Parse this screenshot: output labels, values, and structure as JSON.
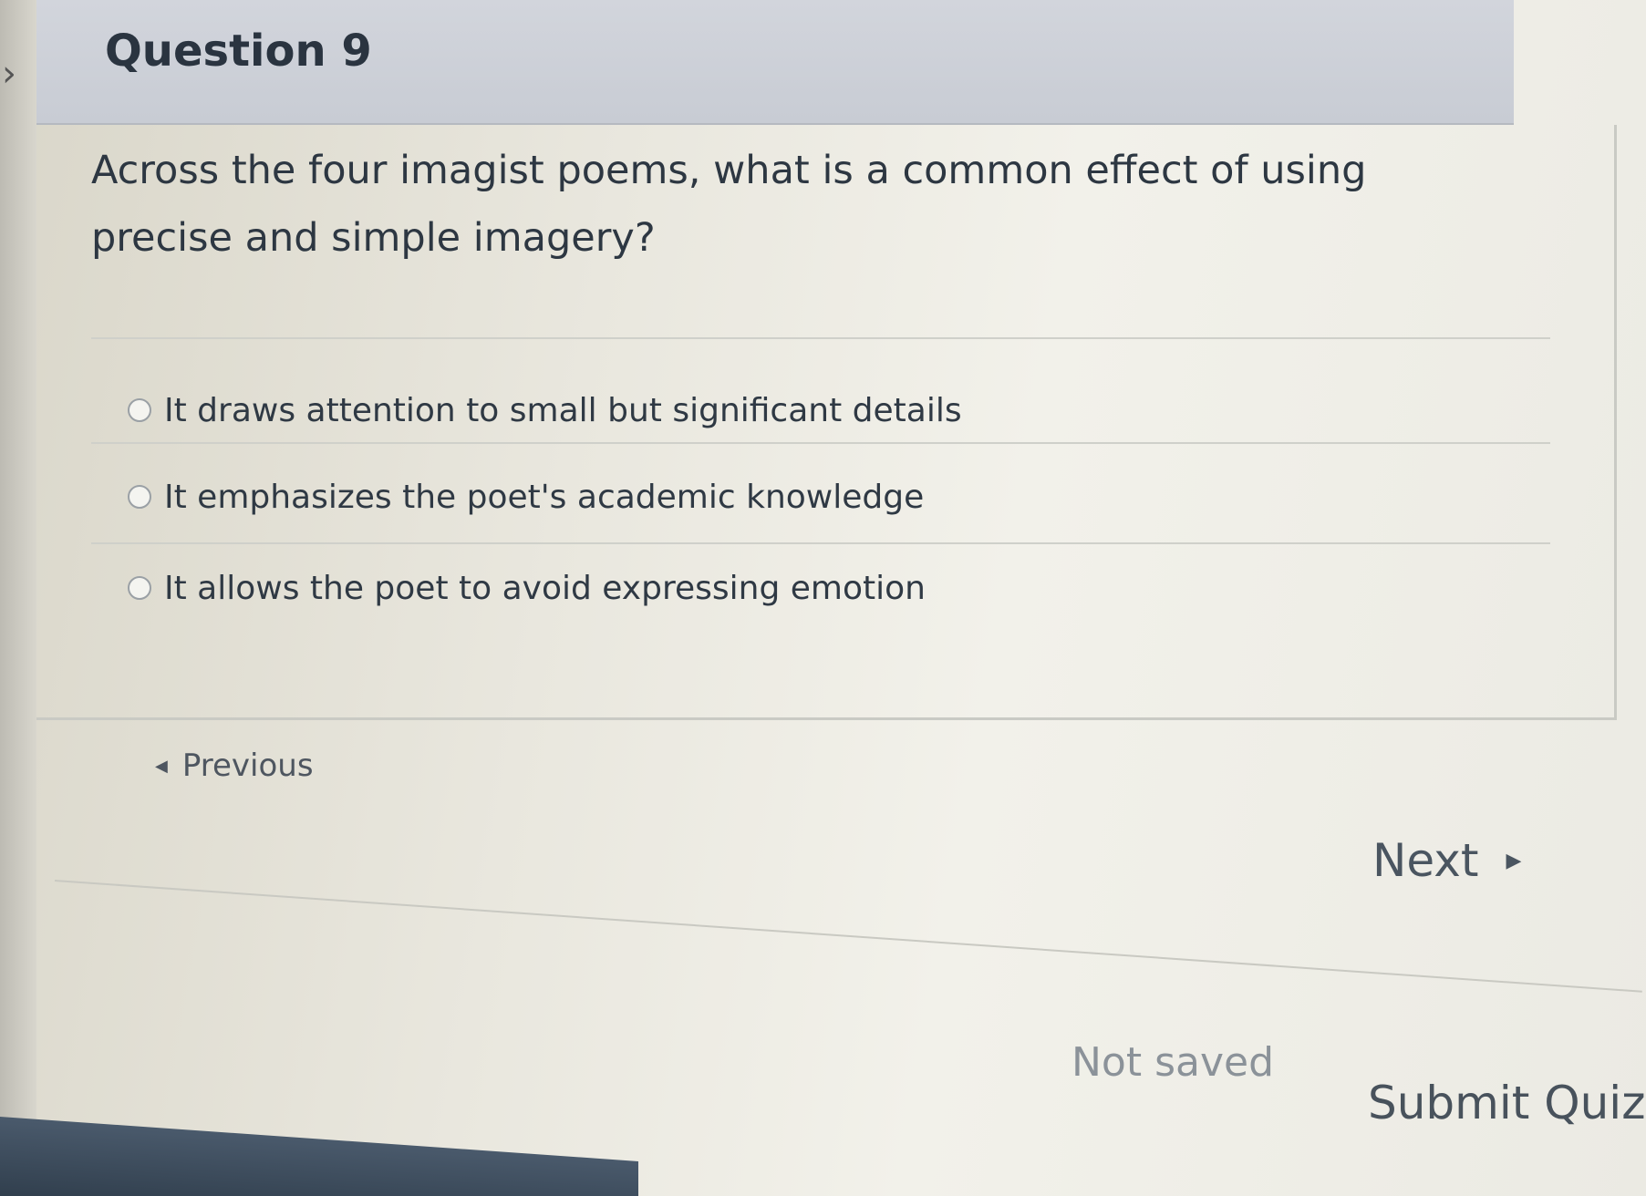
{
  "question": {
    "title": "Question 9",
    "text": "Across the four imagist poems, what is a common effect of using precise and simple imagery?"
  },
  "answers": [
    {
      "label": "It draws attention to small but significant details"
    },
    {
      "label": "It emphasizes the poet's academic knowledge"
    },
    {
      "label": "It allows the poet to avoid expressing emotion"
    }
  ],
  "navigation": {
    "previous_label": "Previous",
    "next_label": "Next"
  },
  "footer": {
    "save_status": "Not saved",
    "submit_label": "Submit Quiz"
  }
}
